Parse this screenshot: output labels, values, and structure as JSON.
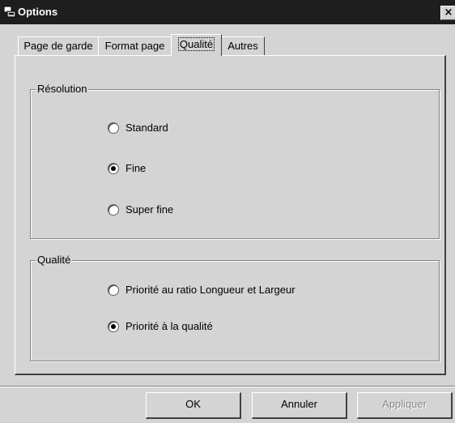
{
  "window": {
    "title": "Options",
    "close_glyph": "×"
  },
  "tabs": [
    {
      "label": "Page de garde",
      "active": false
    },
    {
      "label": "Format page",
      "active": false
    },
    {
      "label": "Qualité",
      "active": true
    },
    {
      "label": "Autres",
      "active": false
    }
  ],
  "resolution": {
    "label": "Résolution",
    "options": [
      {
        "label": "Standard",
        "checked": false
      },
      {
        "label": "Fine",
        "checked": true
      },
      {
        "label": "Super fine",
        "checked": false
      }
    ]
  },
  "quality": {
    "label": "Qualité",
    "options": [
      {
        "label": "Priorité au ratio Longueur et Largeur",
        "checked": false
      },
      {
        "label": "Priorité à la qualité",
        "checked": true
      }
    ]
  },
  "buttons": {
    "ok": {
      "label": "OK",
      "enabled": true
    },
    "cancel": {
      "label": "Annuler",
      "enabled": true
    },
    "apply": {
      "label": "Appliquer",
      "enabled": false
    }
  }
}
